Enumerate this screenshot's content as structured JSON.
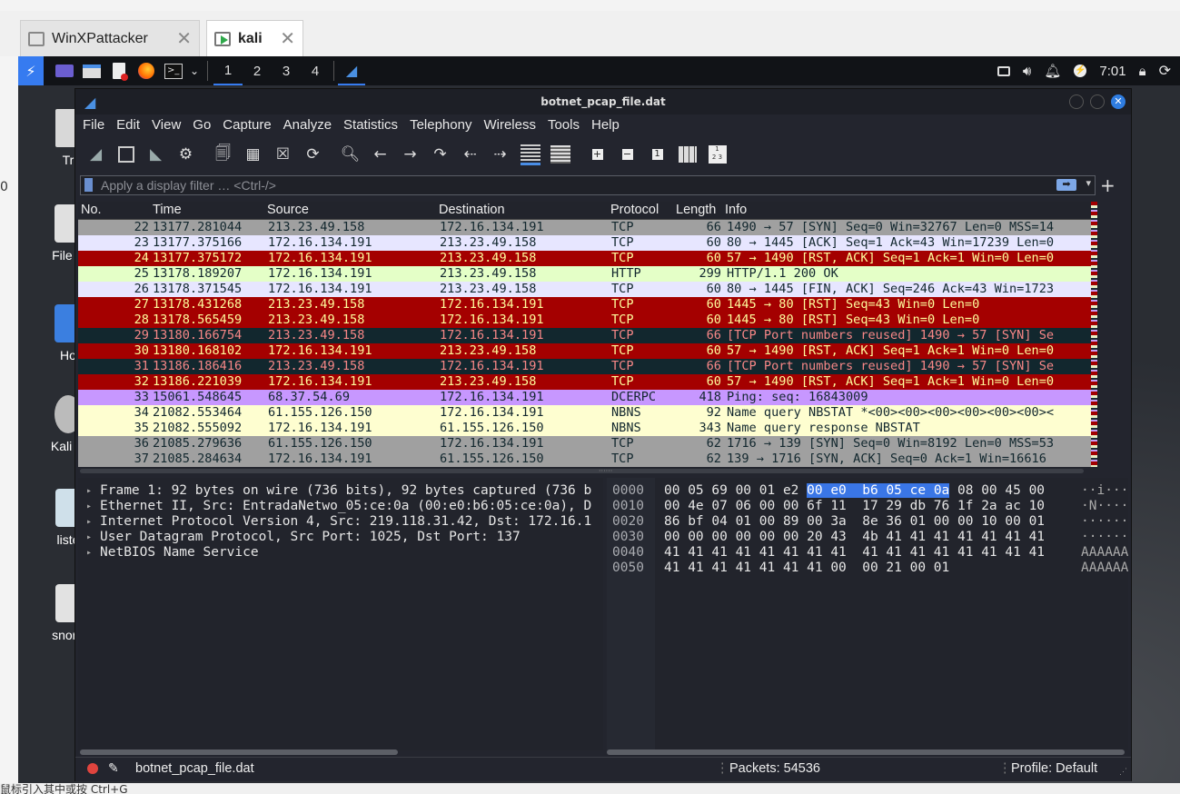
{
  "host": {
    "tabs": [
      {
        "label": "WinXPattacker",
        "active": false
      },
      {
        "label": "kali",
        "active": true
      }
    ],
    "left_edge_char": "0",
    "bottom_text": "鼠标引入其中或按 Ctrl+G"
  },
  "panel": {
    "workspaces": [
      "1",
      "2",
      "3",
      "4"
    ],
    "clock": "7:01"
  },
  "desktop": {
    "icons": [
      {
        "label": "Tr"
      },
      {
        "label": "File S"
      },
      {
        "label": "Ho"
      },
      {
        "label": "Kali Li"
      },
      {
        "label": "liste"
      },
      {
        "label": "snort-"
      }
    ]
  },
  "window": {
    "title": "botnet_pcap_file.dat",
    "menu": [
      "File",
      "Edit",
      "View",
      "Go",
      "Capture",
      "Analyze",
      "Statistics",
      "Telephony",
      "Wireless",
      "Tools",
      "Help"
    ],
    "filter_placeholder": "Apply a display filter … <Ctrl-/>",
    "columns": [
      "No.",
      "Time",
      "Source",
      "Destination",
      "Protocol",
      "Length",
      "Info"
    ],
    "packets": [
      {
        "no": "22",
        "time": "13177.281044",
        "src": "213.23.49.158",
        "dst": "172.16.134.191",
        "proto": "TCP",
        "len": "66",
        "info": "1490 → 57 [SYN] Seq=0 Win=32767 Len=0 MSS=14",
        "bg": "#a0a0a0",
        "fg": "#12272e"
      },
      {
        "no": "23",
        "time": "13177.375166",
        "src": "172.16.134.191",
        "dst": "213.23.49.158",
        "proto": "TCP",
        "len": "60",
        "info": "80 → 1445 [ACK] Seq=1 Ack=43 Win=17239 Len=0",
        "bg": "#e7e6ff",
        "fg": "#12272e"
      },
      {
        "no": "24",
        "time": "13177.375172",
        "src": "172.16.134.191",
        "dst": "213.23.49.158",
        "proto": "TCP",
        "len": "60",
        "info": "57 → 1490 [RST, ACK] Seq=1 Ack=1 Win=0 Len=0",
        "bg": "#a40000",
        "fg": "#fffc9c"
      },
      {
        "no": "25",
        "time": "13178.189207",
        "src": "172.16.134.191",
        "dst": "213.23.49.158",
        "proto": "HTTP",
        "len": "299",
        "info": "HTTP/1.1 200 OK",
        "bg": "#e4ffc7",
        "fg": "#12272e"
      },
      {
        "no": "26",
        "time": "13178.371545",
        "src": "172.16.134.191",
        "dst": "213.23.49.158",
        "proto": "TCP",
        "len": "60",
        "info": "80 → 1445 [FIN, ACK] Seq=246 Ack=43 Win=1723",
        "bg": "#e7e6ff",
        "fg": "#12272e"
      },
      {
        "no": "27",
        "time": "13178.431268",
        "src": "213.23.49.158",
        "dst": "172.16.134.191",
        "proto": "TCP",
        "len": "60",
        "info": "1445 → 80 [RST] Seq=43 Win=0 Len=0",
        "bg": "#a40000",
        "fg": "#fffc9c"
      },
      {
        "no": "28",
        "time": "13178.565459",
        "src": "213.23.49.158",
        "dst": "172.16.134.191",
        "proto": "TCP",
        "len": "60",
        "info": "1445 → 80 [RST] Seq=43 Win=0 Len=0",
        "bg": "#a40000",
        "fg": "#fffc9c"
      },
      {
        "no": "29",
        "time": "13180.166754",
        "src": "213.23.49.158",
        "dst": "172.16.134.191",
        "proto": "TCP",
        "len": "66",
        "info": "[TCP Port numbers reused] 1490 → 57 [SYN] Se",
        "bg": "#12272e",
        "fg": "#f78787"
      },
      {
        "no": "30",
        "time": "13180.168102",
        "src": "172.16.134.191",
        "dst": "213.23.49.158",
        "proto": "TCP",
        "len": "60",
        "info": "57 → 1490 [RST, ACK] Seq=1 Ack=1 Win=0 Len=0",
        "bg": "#a40000",
        "fg": "#fffc9c"
      },
      {
        "no": "31",
        "time": "13186.186416",
        "src": "213.23.49.158",
        "dst": "172.16.134.191",
        "proto": "TCP",
        "len": "66",
        "info": "[TCP Port numbers reused] 1490 → 57 [SYN] Se",
        "bg": "#12272e",
        "fg": "#f78787"
      },
      {
        "no": "32",
        "time": "13186.221039",
        "src": "172.16.134.191",
        "dst": "213.23.49.158",
        "proto": "TCP",
        "len": "60",
        "info": "57 → 1490 [RST, ACK] Seq=1 Ack=1 Win=0 Len=0",
        "bg": "#a40000",
        "fg": "#fffc9c"
      },
      {
        "no": "33",
        "time": "15061.548645",
        "src": "68.37.54.69",
        "dst": "172.16.134.191",
        "proto": "DCERPC",
        "len": "418",
        "info": "Ping: seq: 16843009",
        "bg": "#c797ff",
        "fg": "#12272e"
      },
      {
        "no": "34",
        "time": "21082.553464",
        "src": "61.155.126.150",
        "dst": "172.16.134.191",
        "proto": "NBNS",
        "len": "92",
        "info": "Name query NBSTAT *<00><00><00><00><00><00><",
        "bg": "#fefed0",
        "fg": "#12272e"
      },
      {
        "no": "35",
        "time": "21082.555092",
        "src": "172.16.134.191",
        "dst": "61.155.126.150",
        "proto": "NBNS",
        "len": "343",
        "info": "Name query response NBSTAT",
        "bg": "#fefed0",
        "fg": "#12272e"
      },
      {
        "no": "36",
        "time": "21085.279636",
        "src": "61.155.126.150",
        "dst": "172.16.134.191",
        "proto": "TCP",
        "len": "62",
        "info": "1716 → 139 [SYN] Seq=0 Win=8192 Len=0 MSS=53",
        "bg": "#a0a0a0",
        "fg": "#12272e"
      },
      {
        "no": "37",
        "time": "21085.284634",
        "src": "172.16.134.191",
        "dst": "61.155.126.150",
        "proto": "TCP",
        "len": "62",
        "info": "139 → 1716 [SYN, ACK] Seq=0 Ack=1 Win=16616",
        "bg": "#a0a0a0",
        "fg": "#12272e"
      }
    ],
    "details": [
      "Frame 1: 92 bytes on wire (736 bits), 92 bytes captured (736 b",
      "Ethernet II, Src: EntradaNetwo_05:ce:0a (00:e0:b6:05:ce:0a), D",
      "Internet Protocol Version 4, Src: 219.118.31.42, Dst: 172.16.1",
      "User Datagram Protocol, Src Port: 1025, Dst Port: 137",
      "NetBIOS Name Service"
    ],
    "bytes": [
      {
        "offset": "0000",
        "pre": "00 05 69 00 01 e2 ",
        "hl": "00 e0  b6 05 ce 0a",
        "post": " 08 00 45 00",
        "ascii": "··i···"
      },
      {
        "offset": "0010",
        "pre": "00 4e 07 06 00 00 6f 11  17 29 db 76 1f 2a ac 10",
        "hl": "",
        "post": "",
        "ascii": "·N····"
      },
      {
        "offset": "0020",
        "pre": "86 bf 04 01 00 89 00 3a  8e 36 01 00 00 10 00 01",
        "hl": "",
        "post": "",
        "ascii": "······"
      },
      {
        "offset": "0030",
        "pre": "00 00 00 00 00 00 20 43  4b 41 41 41 41 41 41 41",
        "hl": "",
        "post": "",
        "ascii": "······"
      },
      {
        "offset": "0040",
        "pre": "41 41 41 41 41 41 41 41  41 41 41 41 41 41 41 41",
        "hl": "",
        "post": "",
        "ascii": "AAAAAA"
      },
      {
        "offset": "0050",
        "pre": "41 41 41 41 41 41 41 00  00 21 00 01",
        "hl": "",
        "post": "",
        "ascii": "AAAAAA"
      }
    ],
    "status": {
      "file": "botnet_pcap_file.dat",
      "packets": "Packets: 54536",
      "profile": "Profile: Default"
    }
  }
}
